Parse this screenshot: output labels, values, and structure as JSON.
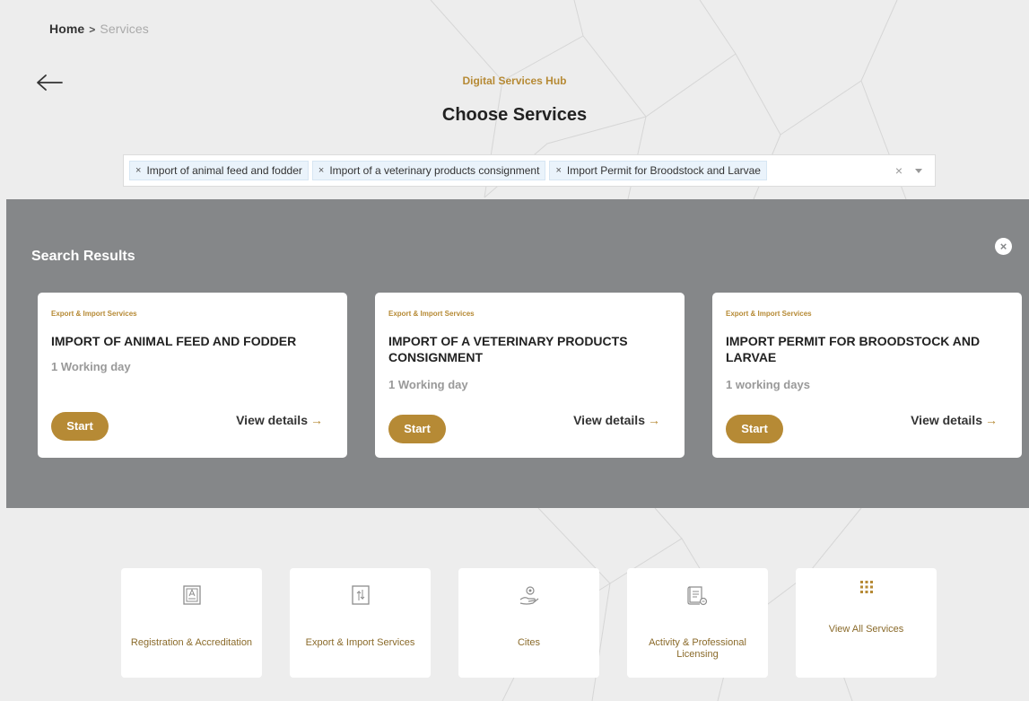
{
  "breadcrumb": {
    "home": "Home",
    "separator": ">",
    "current": "Services"
  },
  "header": {
    "subtitle": "Digital Services Hub",
    "title": "Choose Services"
  },
  "search": {
    "selected": [
      "Import of animal feed and fodder",
      "Import of a veterinary products consignment",
      "Import Permit for Broodstock and Larvae"
    ],
    "chip_remove": "×",
    "clear": "×"
  },
  "results": {
    "title": "Search Results",
    "close": "×",
    "cards": [
      {
        "category": "Export & Import Services",
        "title": "IMPORT OF ANIMAL FEED AND FODDER",
        "duration": "1 Working day",
        "start": "Start",
        "view": "View details",
        "arrow": "→"
      },
      {
        "category": "Export & Import Services",
        "title": "IMPORT OF A VETERINARY PRODUCTS CONSIGNMENT",
        "duration": "1 Working day",
        "start": "Start",
        "view": "View details",
        "arrow": "→"
      },
      {
        "category": "Export & Import Services",
        "title": "IMPORT PERMIT FOR BROODSTOCK AND LARVAE",
        "duration": "1 working days",
        "start": "Start",
        "view": "View details",
        "arrow": "→"
      }
    ]
  },
  "categories": [
    {
      "label": "Registration & Accreditation",
      "icon": "registration-icon"
    },
    {
      "label": "Export & Import Services",
      "icon": "export-import-icon"
    },
    {
      "label": "Cites",
      "icon": "cites-icon"
    },
    {
      "label": "Activity & Professional Licensing",
      "icon": "licensing-icon"
    },
    {
      "label": "View All Services",
      "icon": "grid-icon"
    }
  ],
  "colors": {
    "accent": "#b68a35",
    "results_bg": "#858789",
    "page_bg": "#ededed"
  }
}
